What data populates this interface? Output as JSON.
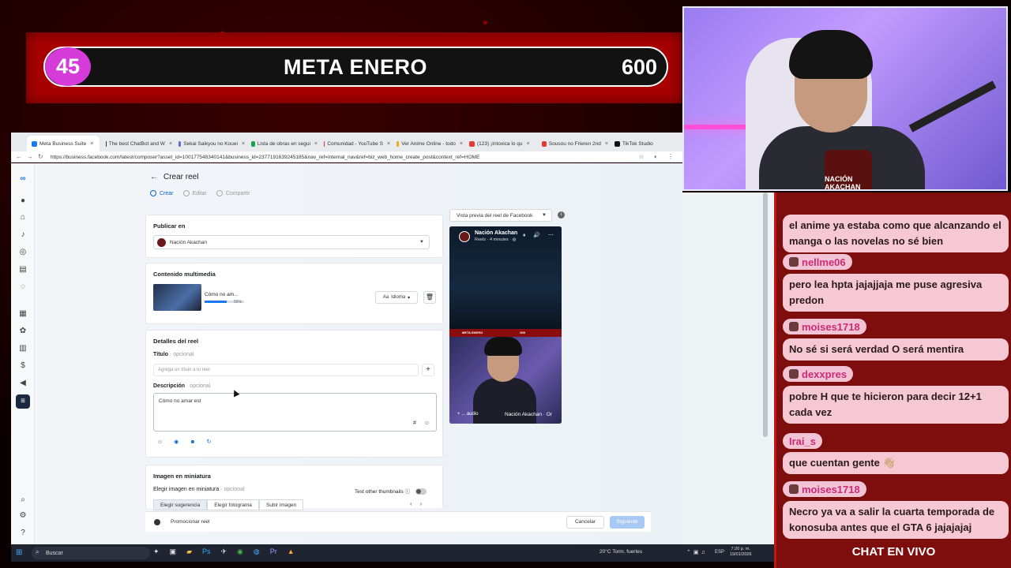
{
  "stream": {
    "goal_count": "45",
    "goal_title": "META ENERO",
    "goal_target": "600",
    "webcam_logo": "NACIÓN AKACHAN",
    "chat_footer": "CHAT EN VIVO"
  },
  "chat": {
    "messages": [
      {
        "user": "",
        "text": "el anime ya estaba como que alcanzando el manga o las novelas no sé bien"
      },
      {
        "user": "nellme06",
        "text": "pero lea hpta jajajjaja me puse agresiva predon"
      },
      {
        "user": "moises1718",
        "text": "No sé si será verdad O será mentira"
      },
      {
        "user": "dexxpres",
        "text": "pobre H que te hicieron para decir 12+1 cada vez"
      },
      {
        "user": "Irai_s",
        "text": "que cuentan gente 👋🏼"
      },
      {
        "user": "moises1718",
        "text": "Necro ya va a salir la cuarta temporada de konosuba antes que el GTA 6 jajajajaj"
      }
    ]
  },
  "browser": {
    "tabs": [
      {
        "label": "Meta Business Suite",
        "color": "#1877f2"
      },
      {
        "label": "The best ChatBot and W",
        "color": "#333333"
      },
      {
        "label": "Sekai Saikyou no Kouei",
        "color": "#5b6fd6"
      },
      {
        "label": "Lista de obras en segui",
        "color": "#16a34a"
      },
      {
        "label": "Comunidad - YouTube S",
        "color": "#e53935"
      },
      {
        "label": "Ver Anime Online - todo",
        "color": "#f5a623"
      },
      {
        "label": "(123) ¡Intoxica lo qu",
        "color": "#e53935"
      },
      {
        "label": "Sousou no Frieren 2nd",
        "color": "#e53935"
      },
      {
        "label": "TikTok Studio",
        "color": "#111111"
      }
    ],
    "url": "https://business.facebook.com/latest/composer?asset_id=100177548340141&business_id=2377191639245185&nav_ref=internal_nav&ref=biz_web_home_create_post&context_ref=HOME"
  },
  "composer": {
    "title": "Crear reel",
    "steps": [
      "Crear",
      "Editar",
      "Compartir"
    ],
    "publish": {
      "heading": "Publicar en",
      "page": "Nación Akachan"
    },
    "media": {
      "heading": "Contenido multimedia",
      "file_name": "Cómo no am...",
      "progress_percent": "56%",
      "progress_fraction": 0.56,
      "language_button": "Idioma"
    },
    "details": {
      "heading": "Detalles del reel",
      "title_label": "Título",
      "optional": "· opcional",
      "title_placeholder": "Agrega un título a tu reel",
      "description_label": "Descripción",
      "description_value": "Cómo no amar est"
    },
    "thumbnail": {
      "heading": "Imagen en miniatura",
      "choose_label": "Elegir imagen en miniatura",
      "optional": "· opcional",
      "test_label": "Test other thumbnails",
      "tabs": [
        "Elegir sugerencia",
        "Elegir fotograma",
        "Subir imagen"
      ]
    },
    "preview": {
      "select_label": "Vista previa del reel de Facebook",
      "page_name": "Nación Akachan",
      "subtitle": "Reels · 4 minutes · ◍",
      "mini_title": "META ENERO",
      "mini_goal": "600",
      "audio_label": "+ ... audio",
      "audio_name": "Nación Akachan · Or"
    },
    "footer": {
      "promote": "Promocionar reel",
      "cancel": "Cancelar",
      "next": "Siguiente"
    }
  },
  "taskbar": {
    "search": "Buscar",
    "weather": "20°C  Torm. fuertes",
    "lang": "ESP",
    "time": "7:20 p. m.",
    "date": "19/01/2026"
  }
}
